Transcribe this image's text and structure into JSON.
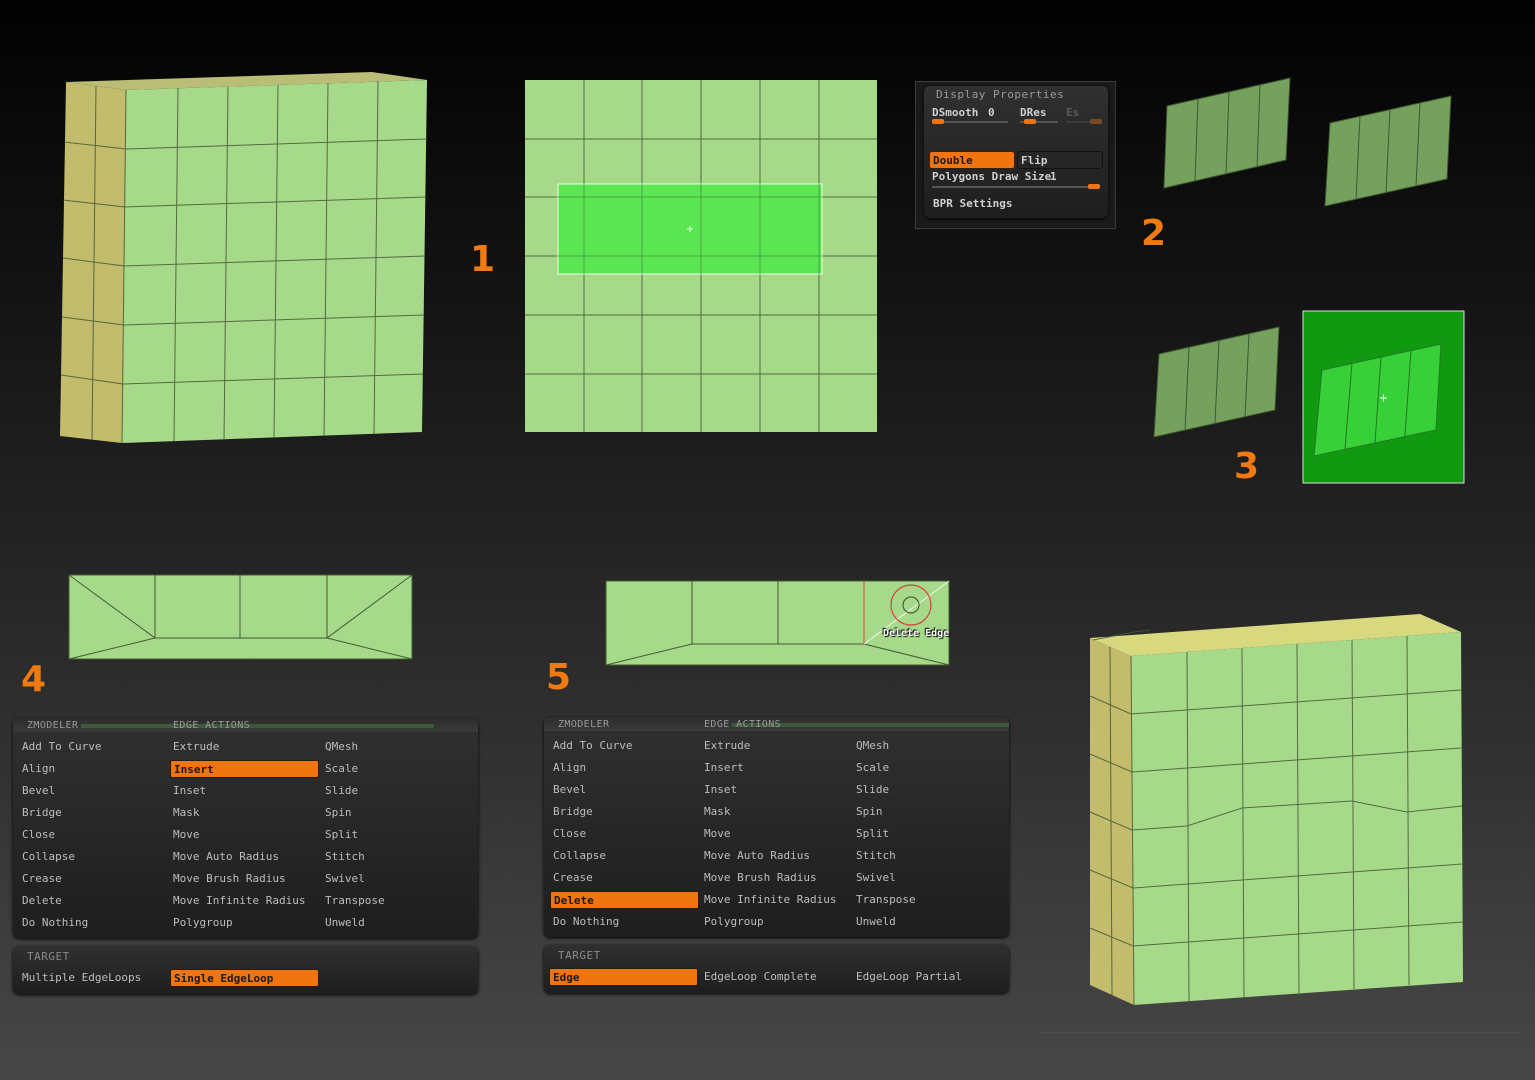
{
  "steps": [
    "1",
    "2",
    "3",
    "4",
    "5"
  ],
  "display_properties": {
    "title": "Display Properties",
    "dsmooth_label": "DSmooth",
    "dsmooth_value": "0",
    "dres_label": "DRes",
    "es_label": "Es",
    "double_label": "Double",
    "flip_label": "Flip",
    "polygons_draw_size_label": "Polygons Draw Size",
    "polygons_draw_size_value": "1",
    "bpr_settings_label": "BPR Settings"
  },
  "tooltip": {
    "delete_edge": "Delete Edge"
  },
  "zmodeler_panel_a": {
    "header_left": "ZMODELER",
    "header_right": "EDGE ACTIONS",
    "col1": [
      "Add To Curve",
      "Align",
      "Bevel",
      "Bridge",
      "Close",
      "Collapse",
      "Crease",
      "Delete",
      "Do Nothing"
    ],
    "col2": [
      "Extrude",
      "Insert",
      "Inset",
      "Mask",
      "Move",
      "Move Auto Radius",
      "Move Brush Radius",
      "Move Infinite Radius",
      "Polygroup"
    ],
    "col3": [
      "QMesh",
      "Scale",
      "Slide",
      "Spin",
      "Split",
      "Stitch",
      "Swivel",
      "Transpose",
      "Unweld"
    ],
    "selected_action": "Insert",
    "target_title": "TARGET",
    "targets": [
      "Multiple EdgeLoops",
      "Single EdgeLoop"
    ],
    "selected_target": "Single EdgeLoop"
  },
  "zmodeler_panel_b": {
    "header_left": "ZMODELER",
    "header_right": "EDGE ACTIONS",
    "col1": [
      "Add To Curve",
      "Align",
      "Bevel",
      "Bridge",
      "Close",
      "Collapse",
      "Crease",
      "Delete",
      "Do Nothing"
    ],
    "col2": [
      "Extrude",
      "Insert",
      "Inset",
      "Mask",
      "Move",
      "Move Auto Radius",
      "Move Brush Radius",
      "Move Infinite Radius",
      "Polygroup"
    ],
    "col3": [
      "QMesh",
      "Scale",
      "Slide",
      "Spin",
      "Split",
      "Stitch",
      "Swivel",
      "Transpose",
      "Unweld"
    ],
    "selected_action": "Delete",
    "target_title": "TARGET",
    "targets": [
      "Edge",
      "EdgeLoop Complete",
      "EdgeLoop Partial"
    ],
    "selected_target": "Edge"
  },
  "colors": {
    "mesh_green": "#a6d98a",
    "mesh_side": "#c2bc6c",
    "selection_green": "#4fe84a",
    "accent_orange": "#f07510",
    "step_orange": "#f07a12"
  }
}
